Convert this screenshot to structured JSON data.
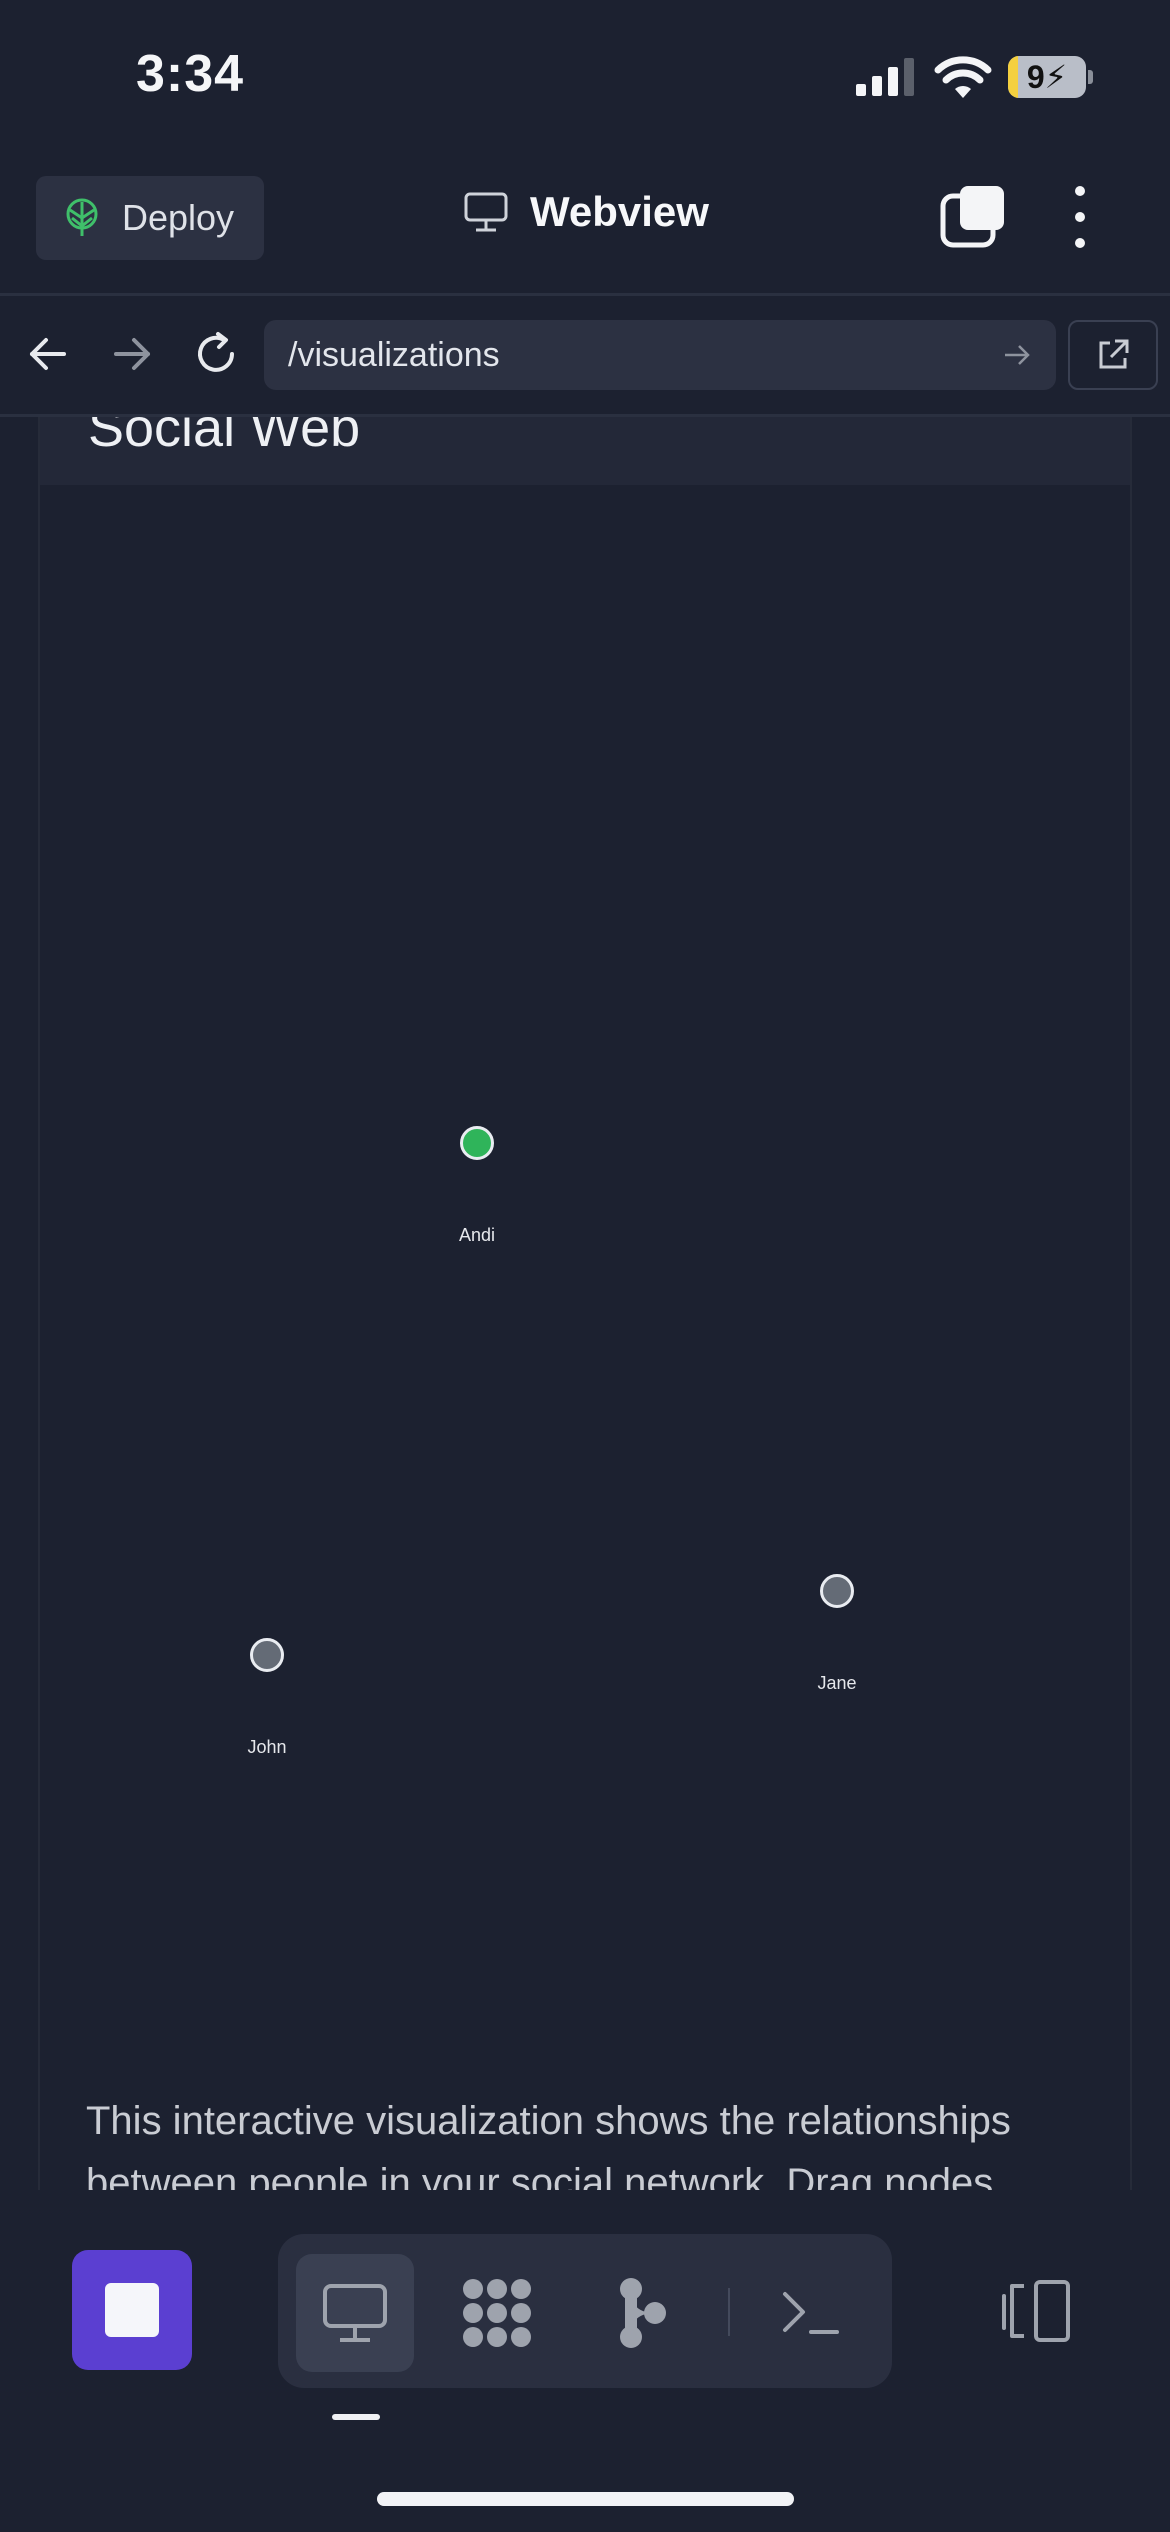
{
  "status_bar": {
    "time": "3:34",
    "battery": "9"
  },
  "header": {
    "deploy_label": "Deploy",
    "title": "Webview"
  },
  "browser": {
    "url": "/visualizations"
  },
  "page": {
    "heading": "Social Web",
    "description": "This interactive visualization shows the relationships between people in your social network. Drag nodes"
  },
  "graph": {
    "nodes": [
      {
        "name": "Andi",
        "color": "#2fb45a"
      },
      {
        "name": "Jane",
        "color": "#646b76"
      },
      {
        "name": "John",
        "color": "#646b76"
      }
    ]
  },
  "toolbar": {
    "tools": [
      "monitor-icon",
      "grid-dots-icon",
      "branch-icon",
      "terminal-icon"
    ],
    "active_tool": "monitor-icon"
  },
  "colors": {
    "accent": "#5b3fd1",
    "deploy_icon": "#3fbf6a",
    "background": "#1c2130"
  }
}
